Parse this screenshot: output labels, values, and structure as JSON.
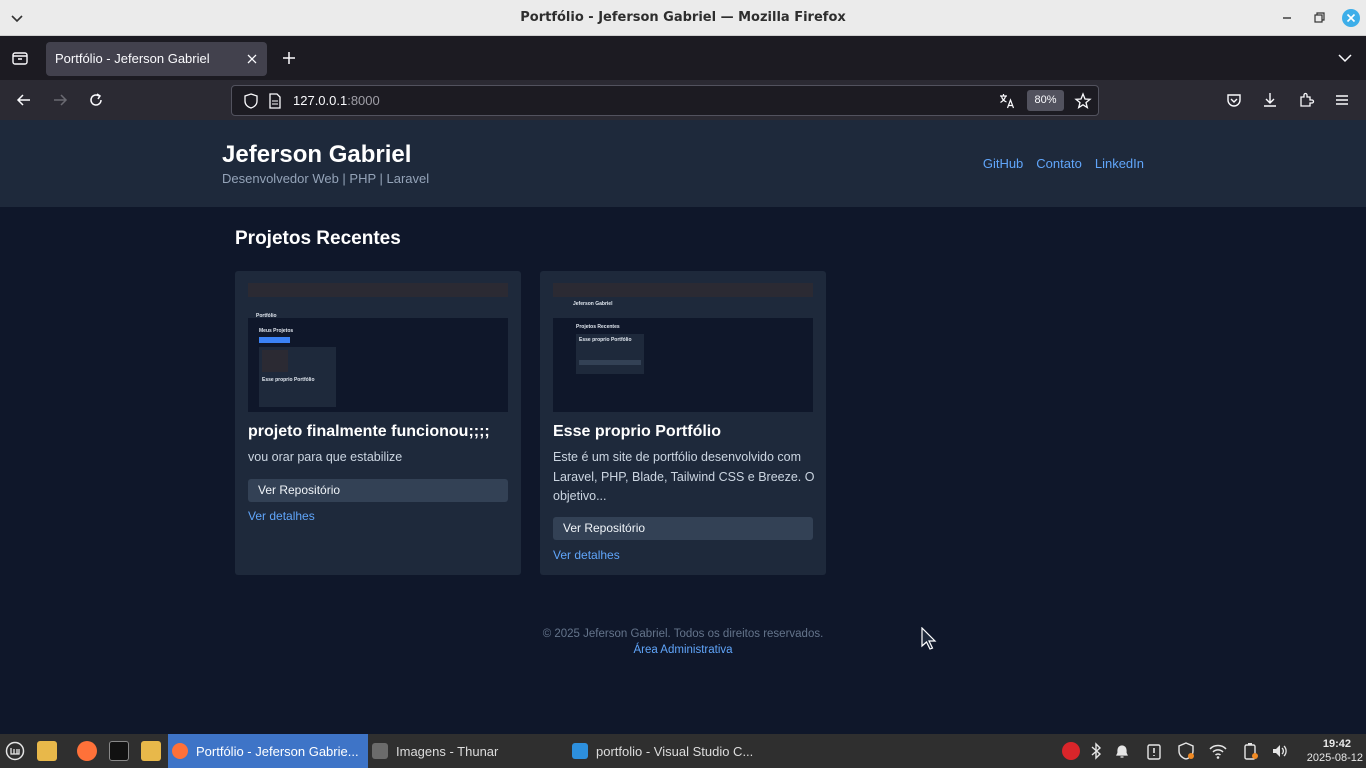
{
  "window": {
    "title": "Portfólio - Jeferson Gabriel — Mozilla Firefox"
  },
  "browser": {
    "tab_title": "Portfólio - Jeferson Gabriel",
    "url_host": "127.0.0.1",
    "url_port": ":8000",
    "zoom": "80%"
  },
  "site": {
    "name": "Jeferson Gabriel",
    "subtitle": "Desenvolvedor Web | PHP | Laravel",
    "nav": [
      "GitHub",
      "Contato",
      "LinkedIn"
    ],
    "section_title": "Projetos Recentes",
    "projects": [
      {
        "title": "projeto finalmente funcionou;;;;",
        "description": "vou orar para que estabilize",
        "repo_label": "Ver Repositório",
        "details_label": "Ver detalhes"
      },
      {
        "title": "Esse proprio Portfólio",
        "description": "Este é um site de portfólio desenvolvido com Laravel, PHP, Blade, Tailwind CSS e Breeze. O objetivo...",
        "repo_label": "Ver Repositório",
        "details_label": "Ver detalhes"
      }
    ],
    "footer_copy": "© 2025 Jeferson Gabriel. Todos os direitos reservados.",
    "footer_admin": "Área Administrativa"
  },
  "thumbs": {
    "t1_name": "Portfólio",
    "t1_heading": "Meus Projetos",
    "t1_card_title": "Esse proprio Portfólio",
    "t2_name": "Jeferson Gabriel",
    "t2_heading": "Projetos Recentes",
    "t2_card_title": "Esse proprio Portfólio"
  },
  "taskbar": {
    "tasks": [
      "Portfólio - Jeferson Gabrie...",
      "Imagens - Thunar",
      "portfolio - Visual Studio C..."
    ],
    "time": "19:42",
    "date": "2025-08-12"
  },
  "colors": {
    "page_bg": "#0f172a",
    "header_bg": "#1e293b",
    "link": "#60a5fa",
    "button_bg": "#334155",
    "taskbar_active": "#3e74c7"
  }
}
